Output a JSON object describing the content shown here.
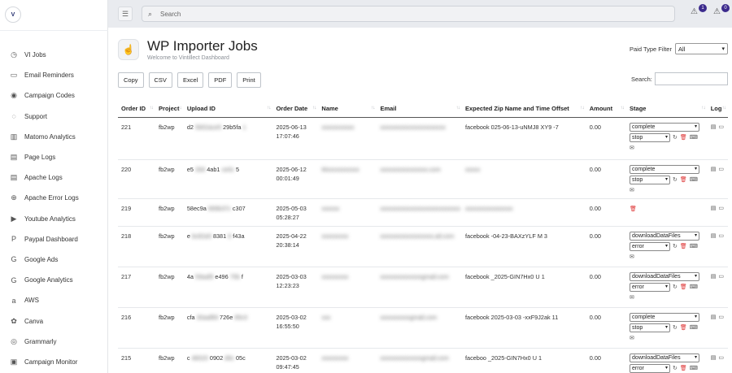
{
  "sidebar": {
    "logo_letter": "V",
    "items": [
      {
        "label": "VI Jobs",
        "icon": "clock-icon",
        "glyph": "◷"
      },
      {
        "label": "Email Reminders",
        "icon": "email-icon",
        "glyph": "▭"
      },
      {
        "label": "Campaign Codes",
        "icon": "broadcast-icon",
        "glyph": "◉"
      },
      {
        "label": "Support",
        "icon": "support-icon",
        "glyph": "◌"
      },
      {
        "label": "Matomo Analytics",
        "icon": "chart-icon",
        "glyph": "▥"
      },
      {
        "label": "Page Logs",
        "icon": "document-icon",
        "glyph": "▤"
      },
      {
        "label": "Apache Logs",
        "icon": "document-icon",
        "glyph": "▤"
      },
      {
        "label": "Apache Error Logs",
        "icon": "globe-icon",
        "glyph": "⊕"
      },
      {
        "label": "Youtube Analytics",
        "icon": "youtube-icon",
        "glyph": "▶"
      },
      {
        "label": "Paypal Dashboard",
        "icon": "paypal-icon",
        "glyph": "P"
      },
      {
        "label": "Google Ads",
        "icon": "google-icon",
        "glyph": "G"
      },
      {
        "label": "Google Analytics",
        "icon": "google-icon",
        "glyph": "G"
      },
      {
        "label": "AWS",
        "icon": "amazon-icon",
        "glyph": "a"
      },
      {
        "label": "Canva",
        "icon": "canva-icon",
        "glyph": "✿"
      },
      {
        "label": "Grammarly",
        "icon": "grammarly-icon",
        "glyph": "◎"
      },
      {
        "label": "Campaign Monitor",
        "icon": "monitor-icon",
        "glyph": "▣"
      }
    ]
  },
  "topbar": {
    "search_placeholder": "Search",
    "notifications": [
      {
        "count": "1"
      },
      {
        "count": "0"
      }
    ]
  },
  "page": {
    "title": "WP Importer Jobs",
    "subtitle": "Welcome to Vintillect Dashboard",
    "filter_label": "Paid Type Filter",
    "filter_value": "All",
    "buttons": [
      "Copy",
      "CSV",
      "Excel",
      "PDF",
      "Print"
    ],
    "search_label": "Search:"
  },
  "table": {
    "headers": [
      "Order ID",
      "Project",
      "Upload ID",
      "Order Date",
      "Name",
      "Email",
      "Expected Zip Name and Time Offset",
      "Amount",
      "Stage",
      "Log"
    ],
    "rows": [
      {
        "id": "221",
        "project": "fb2wp",
        "upload": [
          "d2",
          "5b52ace5",
          "29b5fa",
          "1"
        ],
        "date": [
          "2025-06-13",
          "17:07:46"
        ],
        "name": "xxxxxxxxxxx",
        "email": "xxxxxxxxxxxxxxxxxxxxxx",
        "zip": [
          "facebook",
          "025-06-13-uNMJ8",
          "XY9 -7"
        ],
        "amount": "0.00",
        "stage": "complete",
        "status": "stop",
        "mail": true
      },
      {
        "id": "220",
        "project": "fb2wp",
        "upload": [
          "e5",
          "2b9",
          "4ab1",
          "ce0c",
          "5"
        ],
        "date": [
          "2025-06-12",
          "00:01:49"
        ],
        "name": "Mxxxxxxxxxxx",
        "email": "xxxxxxxxxxxxxxxx.com",
        "zip": [
          "xxxxx"
        ],
        "amount": "0.00",
        "stage": "complete",
        "status": "stop",
        "mail": true
      },
      {
        "id": "219",
        "project": "fb2wp",
        "upload": [
          "58ec9a",
          "999b37c",
          "c307"
        ],
        "date": [
          "2025-05-03",
          "05:28:27"
        ],
        "name": "xxxxxx",
        "email": "xxxxxxxxxxxxxxxxxxxxxxxxxxx",
        "zip": [
          "xxxxxxxxxxxxxxxx"
        ],
        "amount": "0.00",
        "stage": "",
        "status": "",
        "mail": false
      },
      {
        "id": "218",
        "project": "fb2wp",
        "upload": [
          "e",
          "bc82a5",
          "8381",
          "8",
          "f43a"
        ],
        "date": [
          "2025-04-22",
          "20:38:14"
        ],
        "name": "xxxxxxxxx",
        "email": "xxxxxxxxxxxxxxxxxx.ail.com",
        "zip": [
          "facebook",
          "-04-23-BAXzYLF",
          "M 3"
        ],
        "amount": "0.00",
        "stage": "downloadDataFiles",
        "status": "error",
        "mail": true
      },
      {
        "id": "217",
        "project": "fb2wp",
        "upload": [
          "4a",
          "59aaf9",
          "e496",
          "75b",
          "f"
        ],
        "date": [
          "2025-03-03",
          "12:23:23"
        ],
        "name": "xxxxxxxxx",
        "email": "xxxxxxxxxxxxxxgmail.com",
        "zip": [
          "facebook",
          "_2025-GIN7Hx0",
          "U 1"
        ],
        "amount": "0.00",
        "stage": "downloadDataFiles",
        "status": "error",
        "mail": true
      },
      {
        "id": "216",
        "project": "fb2wp",
        "upload": [
          "cfa",
          "30aaf89",
          "726e",
          "85c0"
        ],
        "date": [
          "2025-03-02",
          "16:55:50"
        ],
        "name": "xxx",
        "email": "xxxxxxxxxxgmail.com",
        "zip": [
          "facebook",
          "2025-03-03",
          "-xxF9J2ak 11"
        ],
        "amount": "0.00",
        "stage": "complete",
        "status": "stop",
        "mail": true
      },
      {
        "id": "215",
        "project": "fb2wp",
        "upload": [
          "c",
          "4b520",
          "0902",
          "d6c",
          "05c"
        ],
        "date": [
          "2025-03-02",
          "09:47:45"
        ],
        "name": "xxxxxxxxx",
        "email": "xxxxxxxxxxxxxxgmail.com",
        "zip": [
          "faceboo",
          "_2025-GIN7Hx0",
          "U 1"
        ],
        "amount": "0.00",
        "stage": "downloadDataFiles",
        "status": "error",
        "mail": false
      }
    ]
  }
}
